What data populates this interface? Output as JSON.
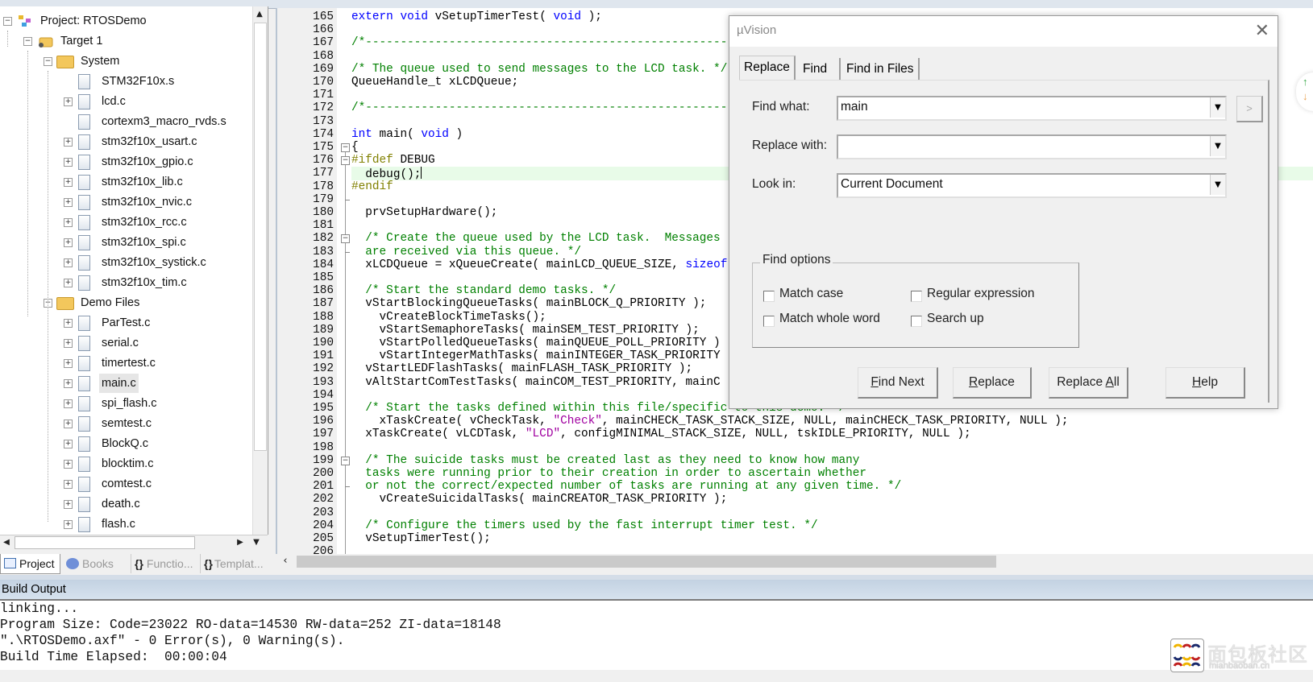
{
  "project_tree": {
    "items": [
      {
        "label": "Project: RTOSDemo",
        "level": 0,
        "icon": "project-icon",
        "expander": "minus"
      },
      {
        "label": "Target 1",
        "level": 1,
        "icon": "target-icon",
        "expander": "minus"
      },
      {
        "label": "System",
        "level": 2,
        "icon": "folder-icon",
        "expander": "minus"
      },
      {
        "label": "STM32F10x.s",
        "level": 3,
        "icon": "file-icon",
        "expander": "none"
      },
      {
        "label": "lcd.c",
        "level": 3,
        "icon": "file-icon",
        "expander": "plus"
      },
      {
        "label": "cortexm3_macro_rvds.s",
        "level": 3,
        "icon": "file-icon",
        "expander": "none"
      },
      {
        "label": "stm32f10x_usart.c",
        "level": 3,
        "icon": "file-icon",
        "expander": "plus"
      },
      {
        "label": "stm32f10x_gpio.c",
        "level": 3,
        "icon": "file-icon",
        "expander": "plus"
      },
      {
        "label": "stm32f10x_lib.c",
        "level": 3,
        "icon": "file-icon",
        "expander": "plus"
      },
      {
        "label": "stm32f10x_nvic.c",
        "level": 3,
        "icon": "file-icon",
        "expander": "plus"
      },
      {
        "label": "stm32f10x_rcc.c",
        "level": 3,
        "icon": "file-icon",
        "expander": "plus"
      },
      {
        "label": "stm32f10x_spi.c",
        "level": 3,
        "icon": "file-icon",
        "expander": "plus"
      },
      {
        "label": "stm32f10x_systick.c",
        "level": 3,
        "icon": "file-icon",
        "expander": "plus"
      },
      {
        "label": "stm32f10x_tim.c",
        "level": 3,
        "icon": "file-icon",
        "expander": "plus"
      },
      {
        "label": "Demo Files",
        "level": 2,
        "icon": "folder-icon",
        "expander": "minus"
      },
      {
        "label": "ParTest.c",
        "level": 3,
        "icon": "file-icon",
        "expander": "plus"
      },
      {
        "label": "serial.c",
        "level": 3,
        "icon": "file-icon",
        "expander": "plus"
      },
      {
        "label": "timertest.c",
        "level": 3,
        "icon": "file-icon",
        "expander": "plus"
      },
      {
        "label": "main.c",
        "level": 3,
        "icon": "file-icon",
        "expander": "plus",
        "selected": true
      },
      {
        "label": "spi_flash.c",
        "level": 3,
        "icon": "file-icon",
        "expander": "plus"
      },
      {
        "label": "semtest.c",
        "level": 3,
        "icon": "file-icon",
        "expander": "plus"
      },
      {
        "label": "BlockQ.c",
        "level": 3,
        "icon": "file-icon",
        "expander": "plus"
      },
      {
        "label": "blocktim.c",
        "level": 3,
        "icon": "file-icon",
        "expander": "plus"
      },
      {
        "label": "comtest.c",
        "level": 3,
        "icon": "file-icon",
        "expander": "plus"
      },
      {
        "label": "death.c",
        "level": 3,
        "icon": "file-icon",
        "expander": "plus"
      },
      {
        "label": "flash.c",
        "level": 3,
        "icon": "file-icon",
        "expander": "plus"
      }
    ]
  },
  "pane_tabs": [
    {
      "label": "Project",
      "icon": "project-window-icon",
      "active": true
    },
    {
      "label": "Books",
      "icon": "books-icon"
    },
    {
      "label": "Functio...",
      "icon": "functions-icon",
      "glyph": "{}"
    },
    {
      "label": "Templat...",
      "icon": "templates-icon",
      "glyph": "{}"
    }
  ],
  "editor": {
    "current_line": 177,
    "colors": {
      "keyword": "#0000ff",
      "comment": "#008000",
      "preprocessor": "#808000",
      "string": "#a000a0"
    },
    "lines": [
      {
        "n": "165",
        "seg": [
          [
            "kw",
            "extern"
          ],
          [
            "pl",
            " "
          ],
          [
            "kw",
            "void"
          ],
          [
            "pl",
            " vSetupTimerTest( "
          ],
          [
            "kw",
            "void"
          ],
          [
            "pl",
            " );"
          ]
        ]
      },
      {
        "n": "166",
        "seg": []
      },
      {
        "n": "167",
        "seg": [
          [
            "cm",
            "/*-----------------------------------------------------------"
          ]
        ]
      },
      {
        "n": "168",
        "seg": []
      },
      {
        "n": "169",
        "seg": [
          [
            "cm",
            "/* The queue used to send messages to the LCD task. */"
          ]
        ]
      },
      {
        "n": "170",
        "seg": [
          [
            "pl",
            "QueueHandle_t xLCDQueue;"
          ]
        ]
      },
      {
        "n": "171",
        "seg": []
      },
      {
        "n": "172",
        "seg": [
          [
            "cm",
            "/*-----------------------------------------------------------"
          ]
        ]
      },
      {
        "n": "173",
        "seg": []
      },
      {
        "n": "174",
        "seg": [
          [
            "kw",
            "int"
          ],
          [
            "pl",
            " main( "
          ],
          [
            "kw",
            "void"
          ],
          [
            "pl",
            " )"
          ]
        ]
      },
      {
        "n": "175",
        "seg": [
          [
            "pl",
            "{"
          ]
        ],
        "fold": "open"
      },
      {
        "n": "176",
        "seg": [
          [
            "pp",
            "#ifdef"
          ],
          [
            "pl",
            " DEBUG"
          ]
        ],
        "fold": "open"
      },
      {
        "n": "177",
        "seg": [
          [
            "pl",
            "  debug();"
          ]
        ]
      },
      {
        "n": "178",
        "seg": [
          [
            "pp",
            "#endif"
          ]
        ]
      },
      {
        "n": "179",
        "seg": [],
        "fold": "end"
      },
      {
        "n": "180",
        "seg": [
          [
            "pl",
            "  prvSetupHardware();"
          ]
        ]
      },
      {
        "n": "181",
        "seg": []
      },
      {
        "n": "182",
        "seg": [
          [
            "cm",
            "  /* Create the queue used by the LCD task.  Messages"
          ]
        ],
        "fold": "open"
      },
      {
        "n": "183",
        "seg": [
          [
            "cm",
            "  are received via this queue. */"
          ]
        ],
        "fold": "end"
      },
      {
        "n": "184",
        "seg": [
          [
            "pl",
            "  xLCDQueue = xQueueCreate( mainLCD_QUEUE_SIZE, "
          ],
          [
            "kw",
            "sizeof"
          ]
        ]
      },
      {
        "n": "185",
        "seg": []
      },
      {
        "n": "186",
        "seg": [
          [
            "cm",
            "  /* Start the standard demo tasks. */"
          ]
        ]
      },
      {
        "n": "187",
        "seg": [
          [
            "pl",
            "  vStartBlockingQueueTasks( mainBLOCK_Q_PRIORITY );"
          ]
        ]
      },
      {
        "n": "188",
        "seg": [
          [
            "pl",
            "    vCreateBlockTimeTasks();"
          ]
        ]
      },
      {
        "n": "189",
        "seg": [
          [
            "pl",
            "    vStartSemaphoreTasks( mainSEM_TEST_PRIORITY );"
          ]
        ]
      },
      {
        "n": "190",
        "seg": [
          [
            "pl",
            "    vStartPolledQueueTasks( mainQUEUE_POLL_PRIORITY )"
          ]
        ]
      },
      {
        "n": "191",
        "seg": [
          [
            "pl",
            "    vStartIntegerMathTasks( mainINTEGER_TASK_PRIORITY"
          ]
        ]
      },
      {
        "n": "192",
        "seg": [
          [
            "pl",
            "  vStartLEDFlashTasks( mainFLASH_TASK_PRIORITY );"
          ]
        ]
      },
      {
        "n": "193",
        "seg": [
          [
            "pl",
            "  vAltStartComTestTasks( mainCOM_TEST_PRIORITY, mainC"
          ]
        ]
      },
      {
        "n": "194",
        "seg": []
      },
      {
        "n": "195",
        "seg": [
          [
            "cm",
            "  /* Start the tasks defined within this file/specific to this demo. */"
          ]
        ]
      },
      {
        "n": "196",
        "seg": [
          [
            "pl",
            "    xTaskCreate( vCheckTask, "
          ],
          [
            "st",
            "\"Check\""
          ],
          [
            "pl",
            ", mainCHECK_TASK_STACK_SIZE, NULL, mainCHECK_TASK_PRIORITY, NULL );"
          ]
        ]
      },
      {
        "n": "197",
        "seg": [
          [
            "pl",
            "  xTaskCreate( vLCDTask, "
          ],
          [
            "st",
            "\"LCD\""
          ],
          [
            "pl",
            ", configMINIMAL_STACK_SIZE, NULL, tskIDLE_PRIORITY, NULL );"
          ]
        ]
      },
      {
        "n": "198",
        "seg": []
      },
      {
        "n": "199",
        "seg": [
          [
            "cm",
            "  /* The suicide tasks must be created last as they need to know how many"
          ]
        ],
        "fold": "open"
      },
      {
        "n": "200",
        "seg": [
          [
            "cm",
            "  tasks were running prior to their creation in order to ascertain whether"
          ]
        ]
      },
      {
        "n": "201",
        "seg": [
          [
            "cm",
            "  or not the correct/expected number of tasks are running at any given time. */"
          ]
        ],
        "fold": "end"
      },
      {
        "n": "202",
        "seg": [
          [
            "pl",
            "    vCreateSuicidalTasks( mainCREATOR_TASK_PRIORITY );"
          ]
        ]
      },
      {
        "n": "203",
        "seg": []
      },
      {
        "n": "204",
        "seg": [
          [
            "cm",
            "  /* Configure the timers used by the fast interrupt timer test. */"
          ]
        ]
      },
      {
        "n": "205",
        "seg": [
          [
            "pl",
            "  vSetupTimerTest();"
          ]
        ]
      },
      {
        "n": "206",
        "seg": []
      }
    ]
  },
  "build_output": {
    "title": "Build Output",
    "lines": [
      "linking...",
      "Program Size: Code=23022 RO-data=14530 RW-data=252 ZI-data=18148",
      "\".\\RTOSDemo.axf\" - 0 Error(s), 0 Warning(s).",
      "Build Time Elapsed:  00:00:04"
    ]
  },
  "dialog": {
    "title": "µVision",
    "tabs": [
      "Replace",
      "Find",
      "Find in Files"
    ],
    "active_tab": "Replace",
    "find_what_label": "Find what:",
    "find_what_value": "main",
    "replace_with_label": "Replace with:",
    "replace_with_value": "",
    "look_in_label": "Look in:",
    "look_in_value": "Current Document",
    "expand_label": ">",
    "find_options_label": "Find options",
    "options": [
      {
        "label": "Match case",
        "checked": false
      },
      {
        "label": "Regular expression",
        "checked": false
      },
      {
        "label": "Match whole word",
        "checked": false
      },
      {
        "label": "Search up",
        "checked": false
      }
    ],
    "buttons": {
      "find_next": {
        "pre": "",
        "u": "F",
        "post": "ind Next"
      },
      "replace": {
        "pre": "",
        "u": "R",
        "post": "eplace"
      },
      "replace_all": {
        "pre": "Replace ",
        "u": "A",
        "post": "ll"
      },
      "help": {
        "pre": "",
        "u": "H",
        "post": "elp"
      }
    }
  },
  "watermark": {
    "text": "面包板社区",
    "url": "mianbaoban.cn"
  }
}
